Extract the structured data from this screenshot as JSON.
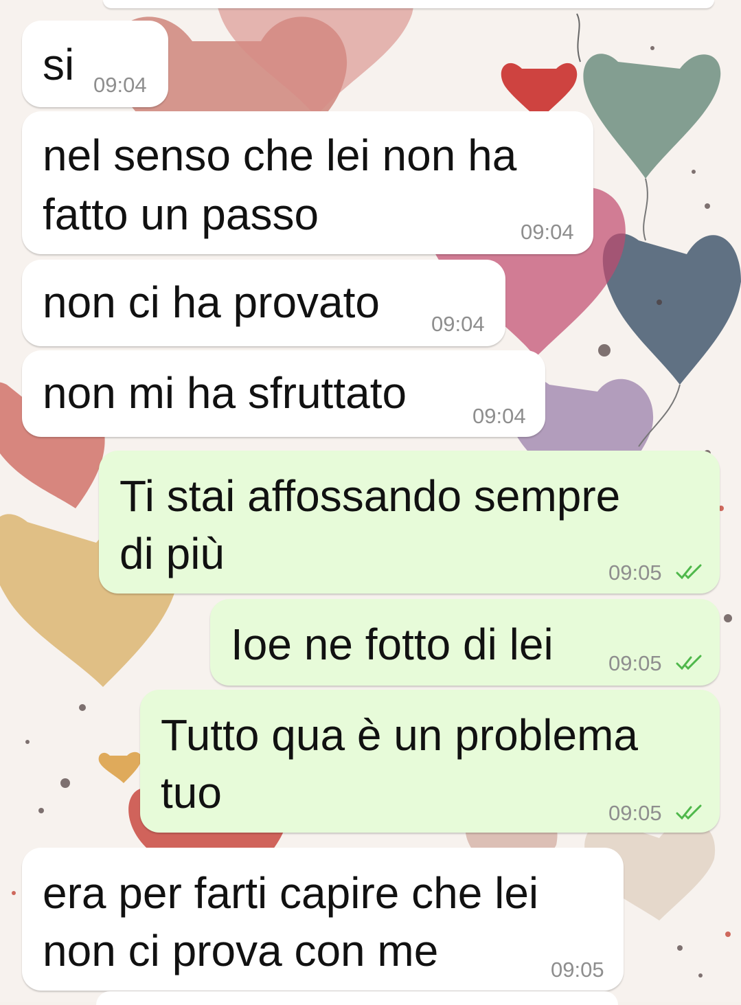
{
  "theme": {
    "incoming_bubble": "#ffffff",
    "outgoing_bubble": "#e7fbd9",
    "read_receipt": "#4fb84b",
    "time_color": "#8e8e8e",
    "wallpaper": "watercolor-hearts-balloons"
  },
  "messages": [
    {
      "direction": "in",
      "lines": [
        "si"
      ],
      "time": "09:04"
    },
    {
      "direction": "in",
      "lines": [
        "nel senso che lei non ha",
        "fatto un passo"
      ],
      "time": "09:04"
    },
    {
      "direction": "in",
      "lines": [
        "non ci ha provato"
      ],
      "time": "09:04"
    },
    {
      "direction": "in",
      "lines": [
        "non mi ha sfruttato"
      ],
      "time": "09:04"
    },
    {
      "direction": "out",
      "lines": [
        "Ti stai affossando sempre",
        "di più"
      ],
      "time": "09:05",
      "status_icon": "double-check-read-icon"
    },
    {
      "direction": "out",
      "lines": [
        "Ioe ne fotto di lei"
      ],
      "time": "09:05",
      "status_icon": "double-check-read-icon"
    },
    {
      "direction": "out",
      "lines": [
        "Tutto qua è un problema",
        "tuo"
      ],
      "time": "09:05",
      "status_icon": "double-check-read-icon"
    },
    {
      "direction": "in",
      "lines": [
        "era per farti capire che lei",
        "non ci prova con me"
      ],
      "time": "09:05"
    }
  ]
}
